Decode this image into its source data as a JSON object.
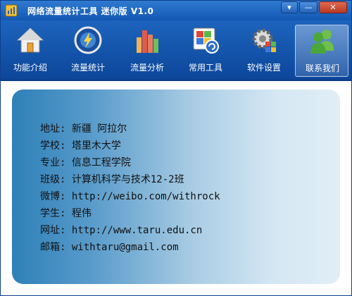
{
  "window": {
    "title": "网络流量统计工具 迷你版 V1.0",
    "controls": {
      "menu": "▾",
      "minimize": "—",
      "close": "✕"
    }
  },
  "toolbar": {
    "items": [
      {
        "label": "功能介绍",
        "icon": "house-icon"
      },
      {
        "label": "流量统计",
        "icon": "gauge-icon"
      },
      {
        "label": "流量分析",
        "icon": "bar-chart-icon"
      },
      {
        "label": "常用工具",
        "icon": "tools-icon"
      },
      {
        "label": "软件设置",
        "icon": "gear-icon"
      },
      {
        "label": "联系我们",
        "icon": "contacts-icon",
        "active": true
      }
    ]
  },
  "info": {
    "address": "地址: 新疆 阿拉尔",
    "school": "学校: 塔里木大学",
    "major": "专业: 信息工程学院",
    "class": "班级: 计算机科学与技术12-2班",
    "weibo": "微博: http://weibo.com/withrock",
    "student": "学生: 程伟",
    "website": "网址: http://www.taru.edu.cn",
    "email": "邮箱: withtaru@gmail.com"
  },
  "colors": {
    "titlebar": "#1f68c2",
    "toolbar": "#1559b0",
    "card_left": "#2e80b8",
    "card_right": "#e1eef7"
  }
}
